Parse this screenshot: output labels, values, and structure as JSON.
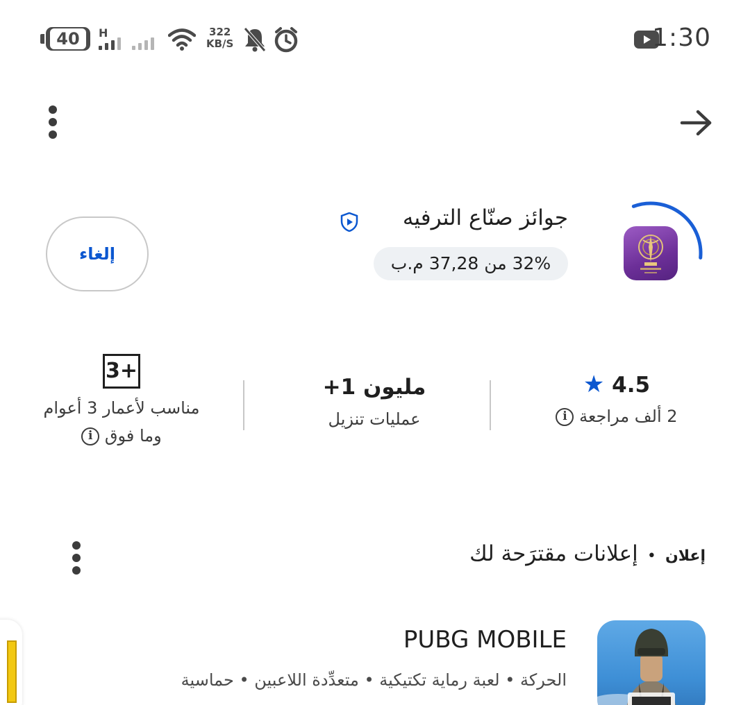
{
  "status_bar": {
    "battery": "40",
    "network_type": "H",
    "speed_value": "322",
    "speed_unit": "KB/S",
    "time": "1:30",
    "icons": [
      "battery-icon",
      "signal-icon",
      "wifi-icon",
      "mute-icon",
      "alarm-icon",
      "youtube-icon"
    ]
  },
  "top_bar": {
    "icons": [
      "more-vert-icon",
      "back-arrow-icon"
    ]
  },
  "app": {
    "title": "جوائز صنّاع الترفيه",
    "progress": "32% من 37,28 م.ب",
    "progress_fraction": 0.32,
    "cancel_label": "إلغاء"
  },
  "stats": {
    "rating": {
      "value": "4.5",
      "reviews": "2 ألف مراجعة"
    },
    "downloads": {
      "value": "+1 مليون",
      "label": "عمليات تنزيل"
    },
    "age": {
      "badge": "3+",
      "line1": "مناسب لأعمار 3 أعوام",
      "line2": "وما فوق"
    }
  },
  "ads": {
    "label": "إعلان",
    "separator": "•",
    "title": "إعلانات مقترَحة لك",
    "items": [
      {
        "name": "PUBG MOBILE",
        "tags": "الحركة • لعبة رماية تكتيكية • متعدِّدة اللاعبين • حماسية"
      }
    ]
  },
  "colors": {
    "accent": "#0b57d0",
    "progress_ring": "#1a5fd6",
    "pill_bg": "#eef1f4"
  }
}
